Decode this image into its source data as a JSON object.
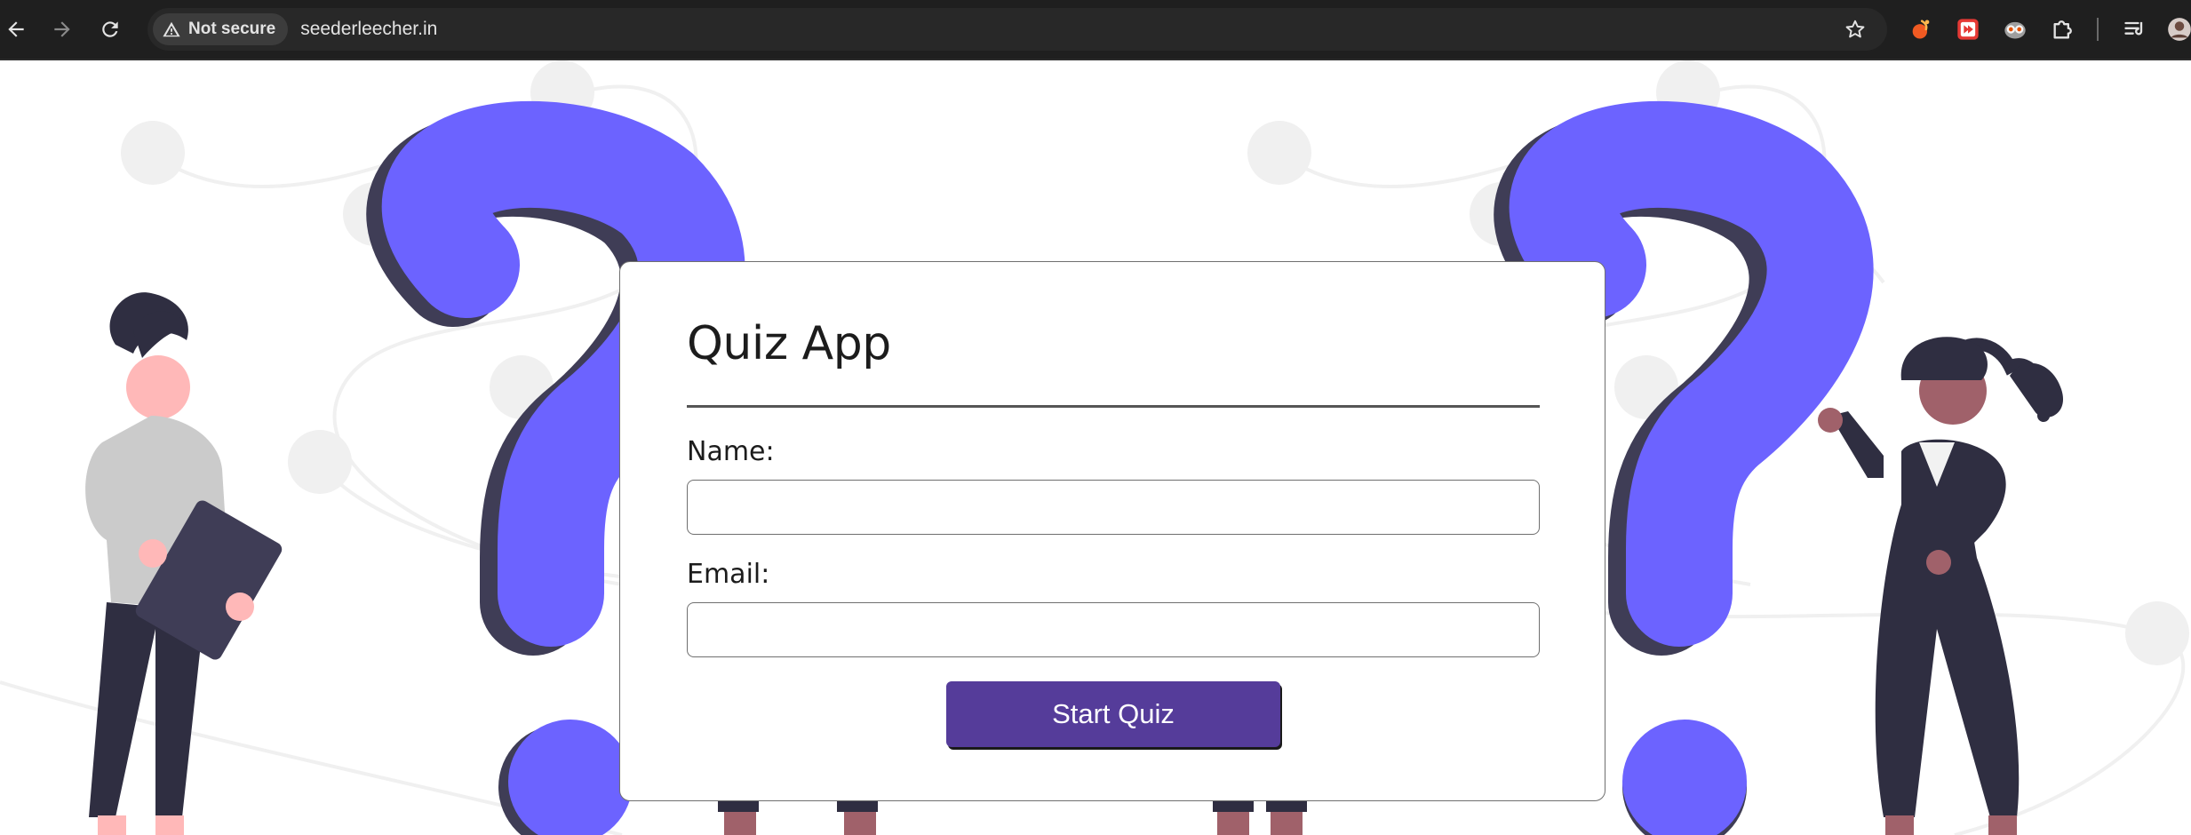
{
  "browser": {
    "security_label": "Not secure",
    "url": "seederleecher.in",
    "icons": {
      "back": "arrow-left-icon",
      "forward": "arrow-right-icon",
      "reload": "reload-icon",
      "security": "warning-triangle-icon",
      "bookmark": "star-icon",
      "extensions": [
        "fire-extension-icon",
        "media-extension-icon",
        "owl-extension-icon",
        "puzzle-extensions-icon",
        "reading-list-icon",
        "profile-avatar-icon"
      ]
    }
  },
  "quiz_form": {
    "title": "Quiz App",
    "name_label": "Name:",
    "name_value": "",
    "email_label": "Email:",
    "email_value": "",
    "submit_label": "Start Quiz"
  },
  "colors": {
    "accent_purple": "#6c63ff",
    "button_purple": "#553c9a",
    "dark_figure": "#2f2e41",
    "skin_light": "#ffb8b8",
    "skin_dark": "#a0616a"
  }
}
